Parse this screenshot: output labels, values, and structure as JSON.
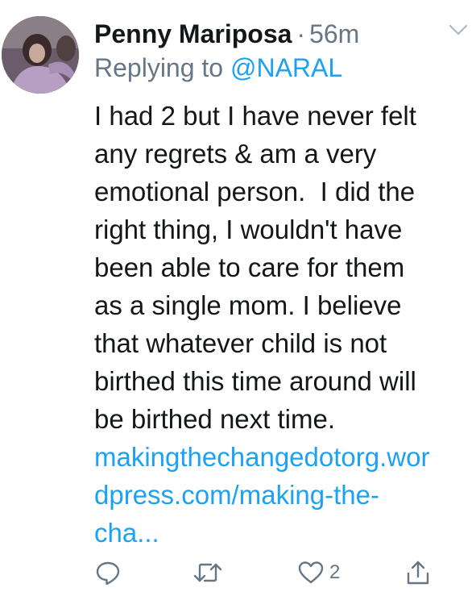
{
  "tweet": {
    "author_name": "Penny Mariposa",
    "separator": "·",
    "time": "56m",
    "replying_prefix": "Replying to",
    "replying_handle": "@NARAL",
    "text_lines": [
      "I had 2 but I have never felt",
      "any regrets & am a very",
      "emotional person.  I did the",
      "right thing, I wouldn't have",
      "been able to care for them",
      "as a single mom. I believe",
      "that whatever child is not",
      "birthed this time around will",
      "be birthed next time."
    ],
    "link_lines": [
      "makingthechangedotorg.wor",
      "dpress.com/making-the-",
      "cha..."
    ],
    "like_count": "2"
  },
  "icons": {
    "menu": "chevron-down-icon",
    "reply": "reply-icon",
    "retweet": "retweet-icon",
    "like": "heart-icon",
    "share": "share-icon"
  },
  "colors": {
    "text": "#14171a",
    "secondary": "#657786",
    "link": "#1da1f2"
  }
}
